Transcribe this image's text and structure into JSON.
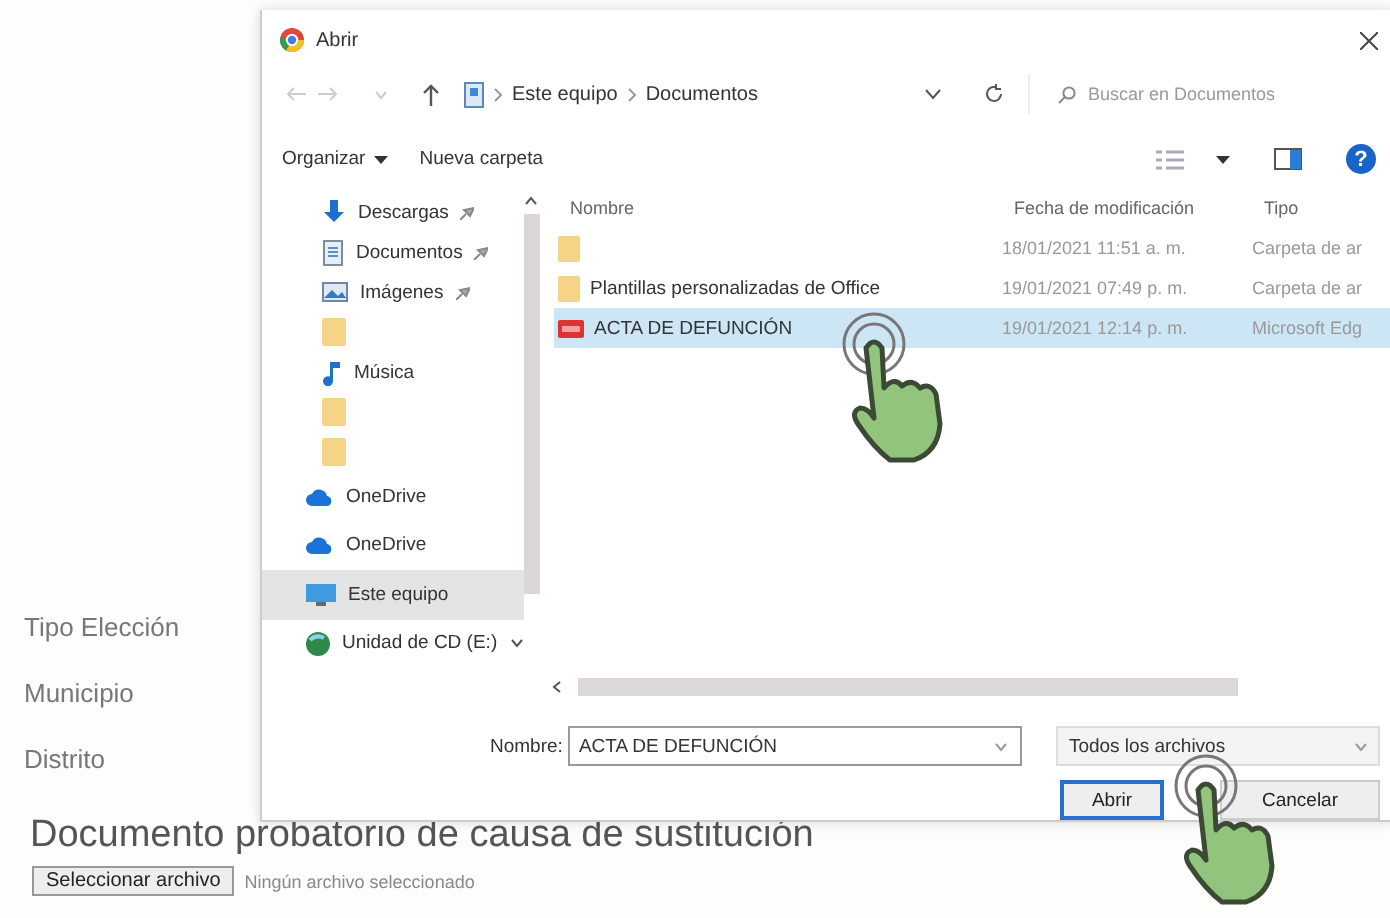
{
  "page": {
    "fields": [
      {
        "label": "Tipo Elección"
      },
      {
        "label": "Municipio"
      },
      {
        "label": "Distrito"
      }
    ],
    "heading": "Documento probatorio de causa de sustitución",
    "file_input": {
      "button": "Seleccionar archivo",
      "status": "Ningún archivo seleccionado"
    }
  },
  "dialog": {
    "title": "Abrir",
    "breadcrumb": [
      "Este equipo",
      "Documentos"
    ],
    "help_glyph": "?",
    "search": {
      "placeholder": "Buscar en Documentos"
    },
    "toolbar": {
      "organize": "Organizar",
      "new_folder": "Nueva carpeta"
    },
    "nav": [
      {
        "kind": "downloads",
        "label": "Descargas",
        "pinned": true,
        "selected": false
      },
      {
        "kind": "documents",
        "label": "Documentos",
        "pinned": true,
        "selected": false
      },
      {
        "kind": "images",
        "label": "Imágenes",
        "pinned": true,
        "selected": false
      },
      {
        "kind": "folder",
        "pinned": false,
        "selected": false
      },
      {
        "kind": "music",
        "label": "Música",
        "pinned": false,
        "selected": false
      },
      {
        "kind": "folder",
        "pinned": false,
        "selected": false
      },
      {
        "kind": "folder",
        "pinned": false,
        "selected": false
      },
      {
        "kind": "onedrive",
        "label": "OneDrive",
        "pinned": false,
        "selected": false
      },
      {
        "kind": "onedrive",
        "label": "OneDrive",
        "pinned": false,
        "selected": false
      },
      {
        "kind": "pc",
        "label": "Este equipo",
        "pinned": false,
        "selected": true
      },
      {
        "kind": "cd",
        "label": "Unidad de CD (E:)",
        "pinned": false,
        "selected": false
      }
    ],
    "columns": [
      "Nombre",
      "Fecha de modificación",
      "Tipo"
    ],
    "files": [
      {
        "kind": "folder",
        "date": "18/01/2021 11:51 a. m.",
        "type": "Carpeta de ar",
        "selected": false
      },
      {
        "kind": "folder",
        "name": "Plantillas personalizadas de Office",
        "date": "19/01/2021 07:49 p. m.",
        "type": "Carpeta de ar",
        "selected": false
      },
      {
        "kind": "pdf",
        "name": "ACTA DE DEFUNCIÓN",
        "date": "19/01/2021 12:14 p. m.",
        "type": "Microsoft Edg",
        "selected": true
      }
    ],
    "name_label": "Nombre:",
    "name_value": "ACTA DE DEFUNCIÓN",
    "filter": "Todos los archivos",
    "buttons": [
      {
        "label": "Abrir",
        "focused": true
      },
      {
        "label": "Cancelar",
        "focused": false
      }
    ]
  }
}
